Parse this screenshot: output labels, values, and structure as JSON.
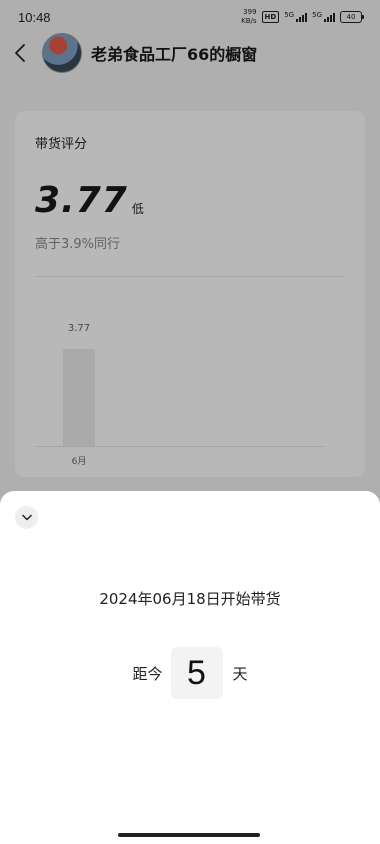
{
  "status_bar": {
    "time": "10:48",
    "net_speed_top": "399",
    "net_speed_bottom": "KB/s",
    "hd_label": "HD",
    "sim1_label": "5G",
    "sim2_label": "5G",
    "battery": "40"
  },
  "header": {
    "shop_title": "老弟食品工厂66的橱窗"
  },
  "score_card": {
    "title": "带货评分",
    "score": "3.77",
    "level": "低",
    "compare_text": "高于3.9%同行"
  },
  "chart_data": {
    "type": "bar",
    "categories": [
      "6月"
    ],
    "values": [
      3.77
    ],
    "data_labels": [
      "3.77"
    ],
    "title": "",
    "xlabel": "",
    "ylabel": ""
  },
  "sheet": {
    "start_text": "2024年06月18日开始带货",
    "countdown_prefix": "距今",
    "countdown_value": "5",
    "countdown_suffix": "天"
  }
}
